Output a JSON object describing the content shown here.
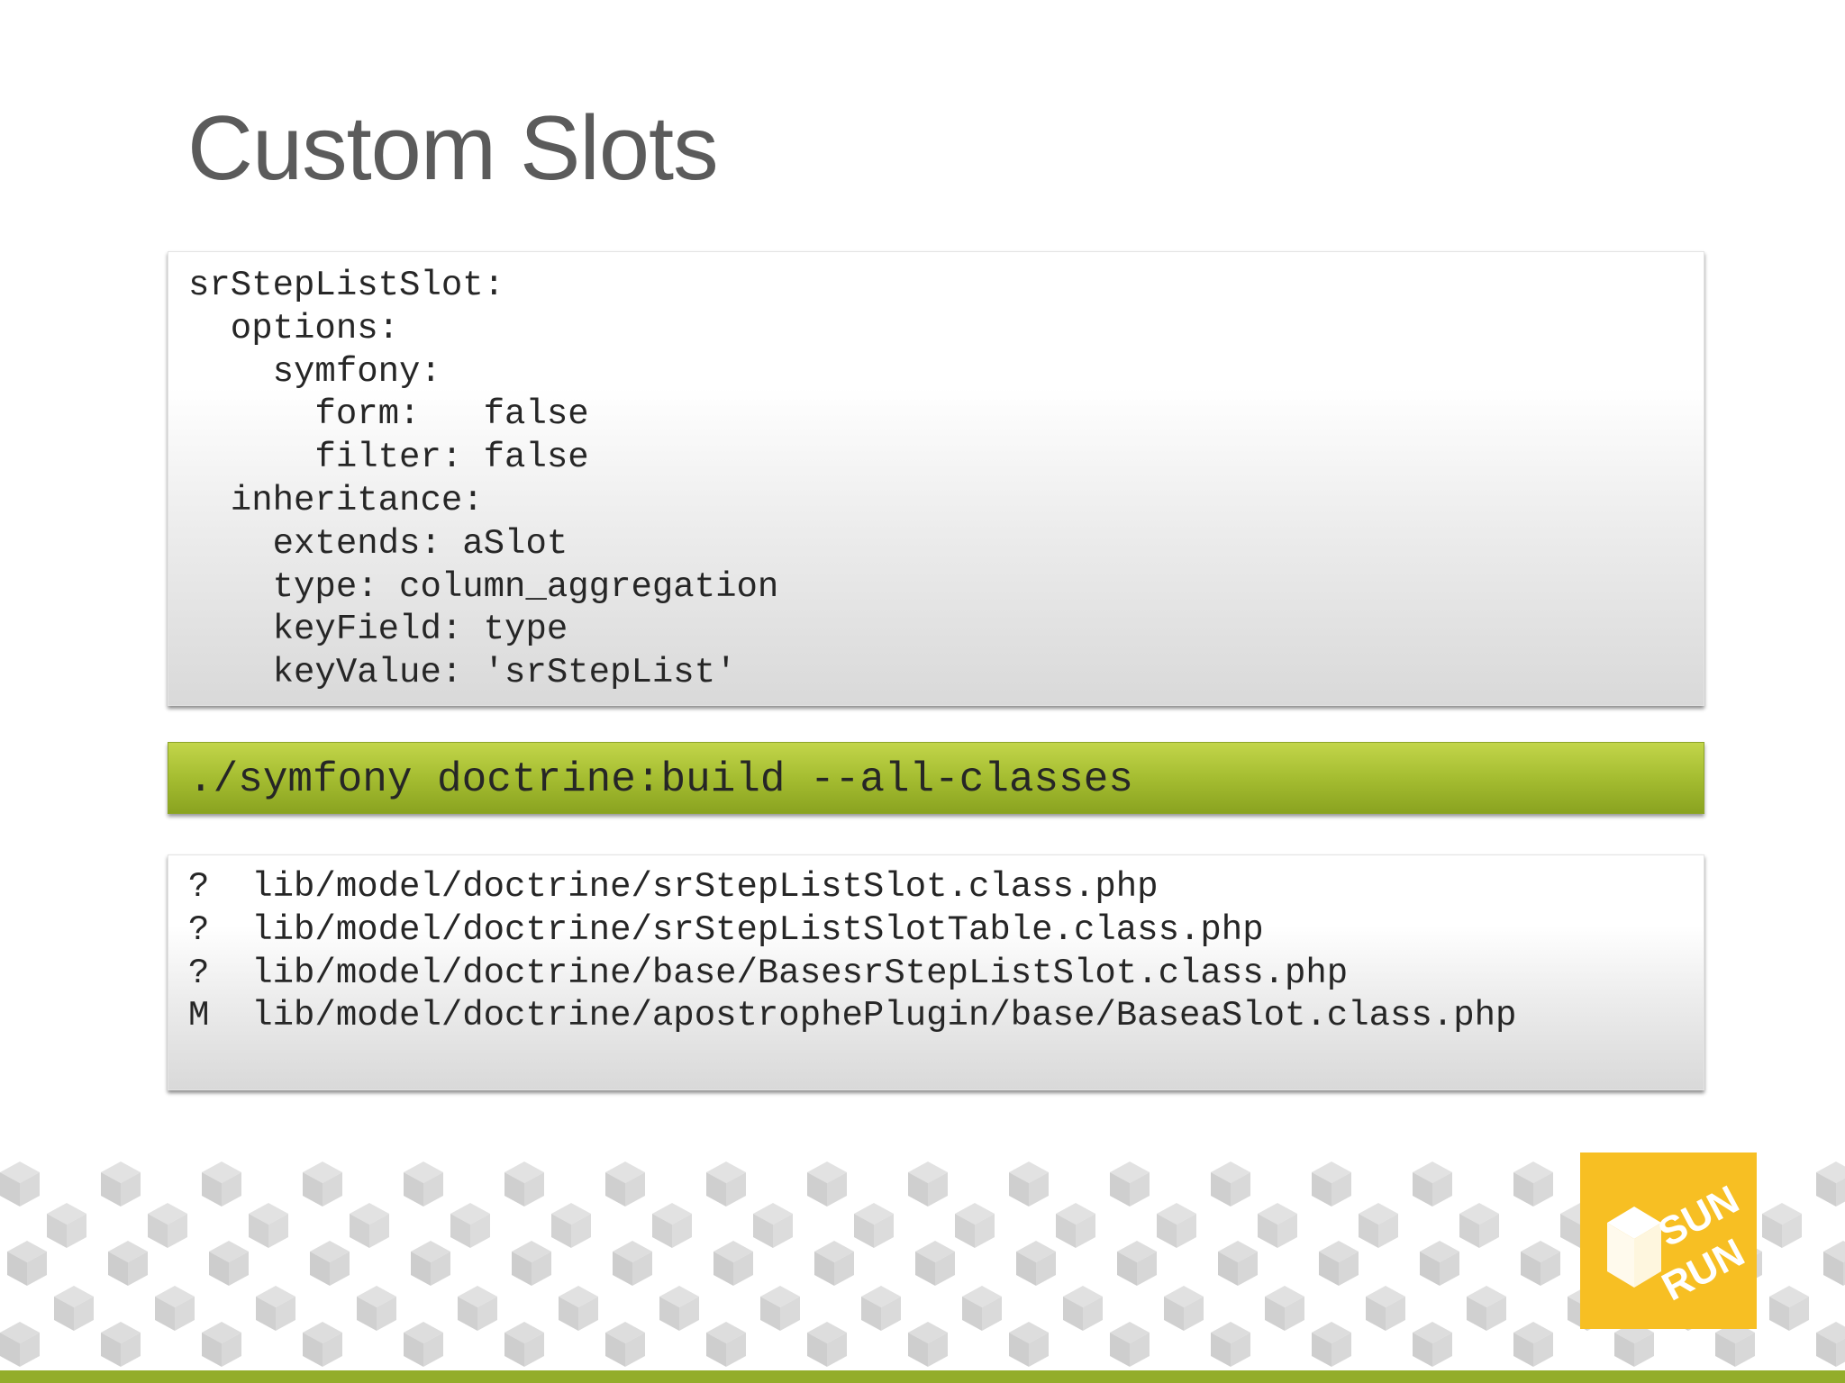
{
  "slide": {
    "title": "Custom Slots"
  },
  "yaml_block": {
    "lines": [
      "srStepListSlot:",
      "  options:",
      "    symfony:",
      "      form:   false",
      "      filter: false",
      "  inheritance:",
      "    extends: aSlot",
      "    type: column_aggregation",
      "    keyField: type",
      "    keyValue: 'srStepList'"
    ]
  },
  "command": {
    "text": "./symfony doctrine:build --all-classes"
  },
  "files_block": {
    "lines": [
      "?  lib/model/doctrine/srStepListSlot.class.php",
      "?  lib/model/doctrine/srStepListSlotTable.class.php",
      "?  lib/model/doctrine/base/BasesrStepListSlot.class.php",
      "M  lib/model/doctrine/apostrophePlugin/base/BaseaSlot.class.php"
    ]
  },
  "logo": {
    "text_top": "SUN",
    "text_bottom": "RUN",
    "background_color": "#f7bf23",
    "mark_color": "#ffffff",
    "icon": "sunrun-logo-icon"
  },
  "theme": {
    "accent_green": "#9fb82e",
    "title_color": "#5b5b5b",
    "pattern_color": "#dadada"
  }
}
